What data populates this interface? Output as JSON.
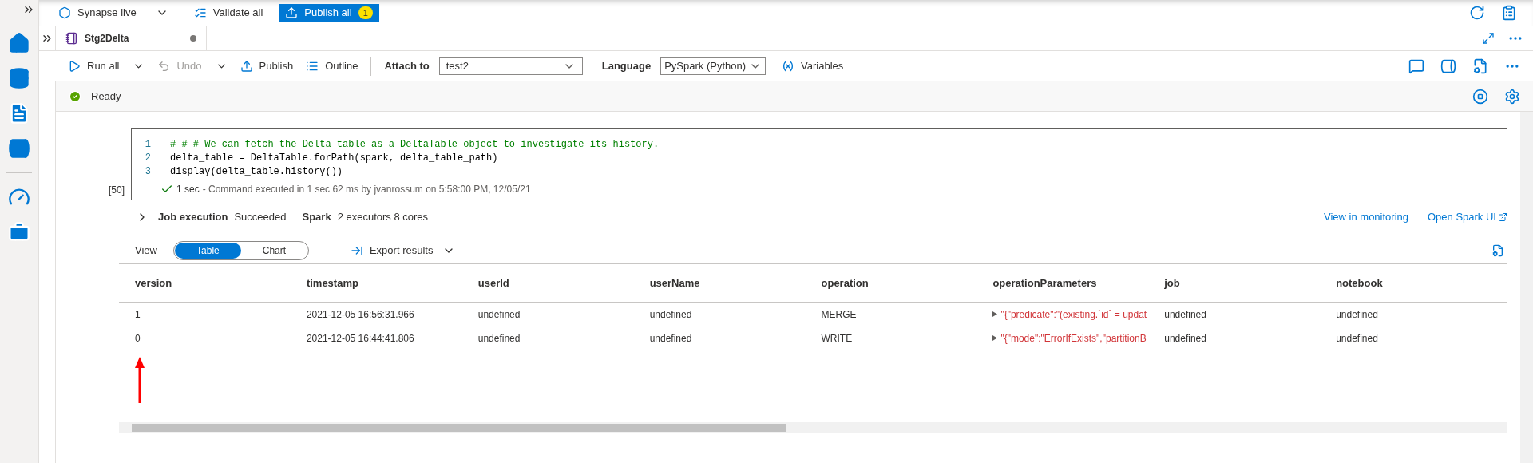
{
  "top_bar": {
    "workspace": "Synapse live",
    "validate": "Validate all",
    "publish": "Publish all",
    "publish_count": "1"
  },
  "tab": {
    "title": "Stg2Delta",
    "unsaved": true
  },
  "toolbar": {
    "run_all": "Run all",
    "undo": {
      "label": "Undo",
      "disabled": true
    },
    "publish": "Publish",
    "outline": "Outline",
    "attach_label": "Attach to",
    "attach_value": "test2",
    "language_label": "Language",
    "language_value": "PySpark (Python)",
    "variables": "Variables"
  },
  "status": "Ready",
  "cell": {
    "execution_count": "[50]",
    "lines": [
      {
        "number": "1",
        "kind": "comment",
        "text": "# # # We can fetch the Delta table as a DeltaTable object to investigate its history."
      },
      {
        "number": "2",
        "kind": "code",
        "text": "delta_table = DeltaTable.forPath(spark, delta_table_path)"
      },
      {
        "number": "3",
        "kind": "code",
        "text": "display(delta_table.history())"
      }
    ],
    "duration": "1 sec",
    "message": "- Command executed in 1 sec 62 ms by jvanrossum on 5:58:00 PM, 12/05/21"
  },
  "job": {
    "label": "Job execution",
    "result": "Succeeded",
    "spark_label": "Spark",
    "spark_info": "2 executors 8 cores",
    "expanded": false,
    "links": [
      "View in monitoring",
      "Open Spark UI"
    ]
  },
  "results": {
    "view_label": "View",
    "views": [
      {
        "label": "Table",
        "selected": true
      },
      {
        "label": "Chart",
        "selected": false
      }
    ],
    "export": "Export results",
    "columns": [
      "version",
      "timestamp",
      "userId",
      "userName",
      "operation",
      "operationParameters",
      "job",
      "notebook"
    ],
    "rows": [
      [
        "1",
        "2021-12-05 16:56:31.966",
        "undefined",
        "undefined",
        "MERGE",
        "\"{\"predicate\":\"(existing.`id` = updat",
        "undefined",
        "undefined"
      ],
      [
        "0",
        "2021-12-05 16:44:41.806",
        "undefined",
        "undefined",
        "WRITE",
        "\"{\"mode\":\"ErrorIfExists\",\"partitionB",
        "undefined",
        "undefined"
      ]
    ]
  }
}
